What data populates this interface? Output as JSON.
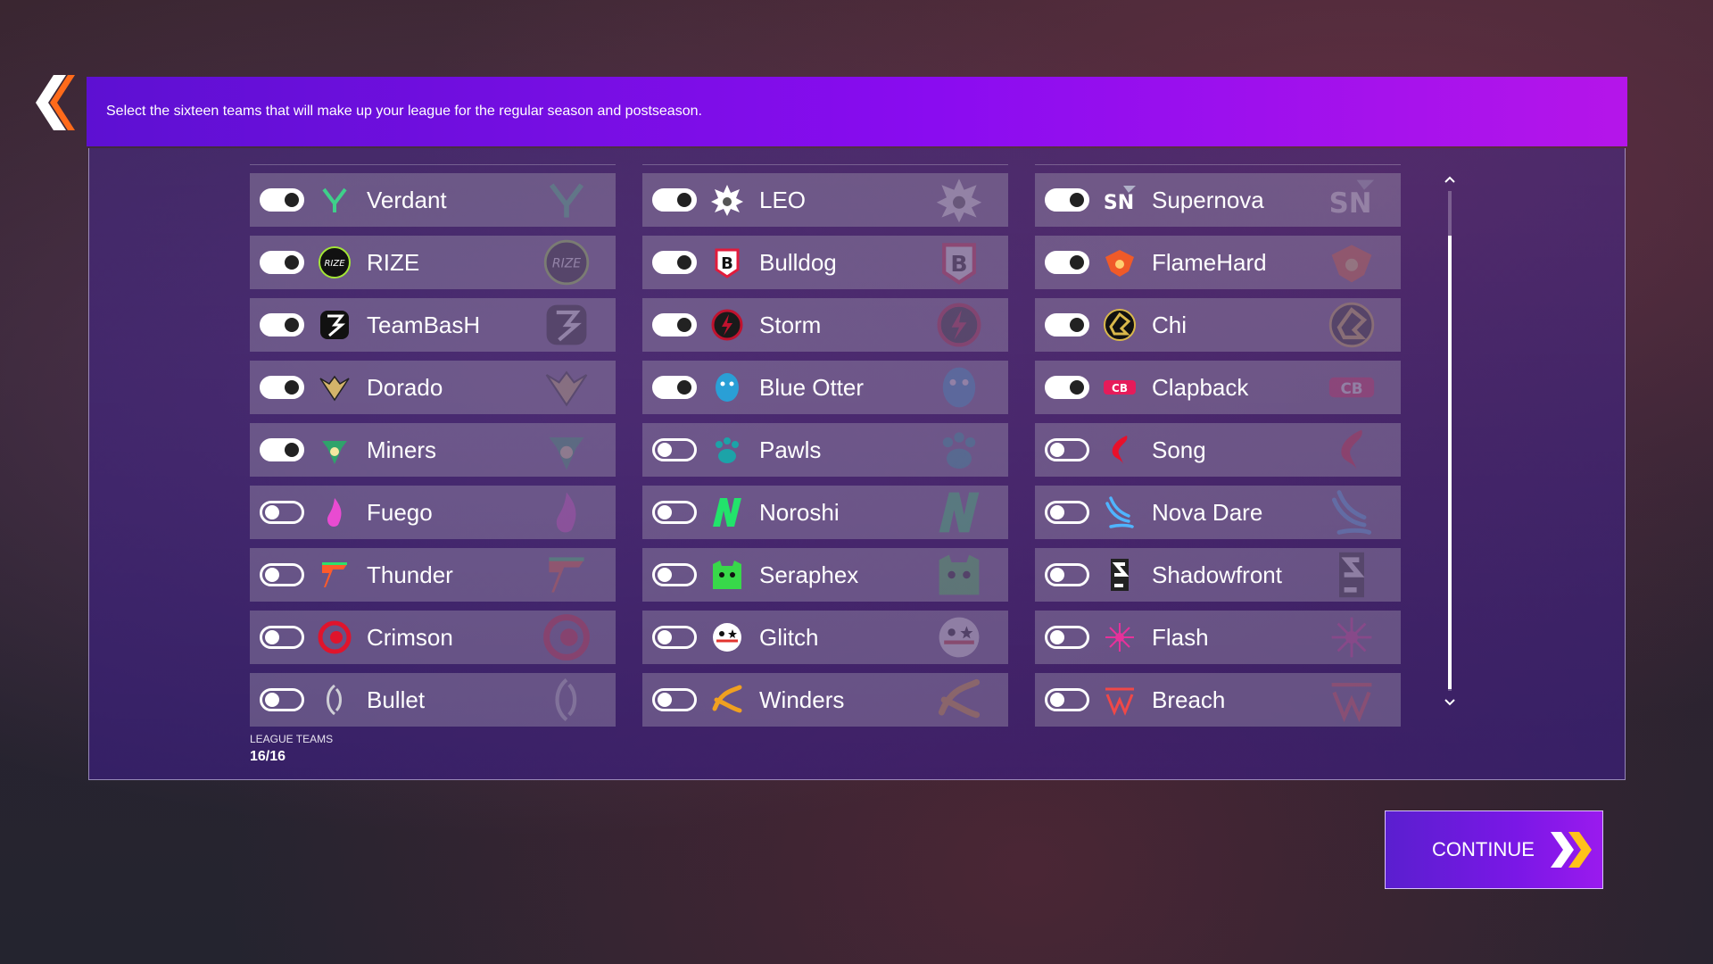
{
  "header": {
    "instruction": "Select the sixteen teams that will make up your league for the regular season and postseason."
  },
  "columns": [
    [
      {
        "name": "Verdant",
        "enabled": true,
        "icon": "verdant-logo-icon",
        "color": "#3fd08a"
      },
      {
        "name": "RIZE",
        "enabled": true,
        "icon": "rize-logo-icon",
        "color": "#a3e635"
      },
      {
        "name": "TeamBasH",
        "enabled": true,
        "icon": "teambash-logo-icon",
        "color": "#111111"
      },
      {
        "name": "Dorado",
        "enabled": true,
        "icon": "dorado-logo-icon",
        "color": "#d4b46a"
      },
      {
        "name": "Miners",
        "enabled": true,
        "icon": "miners-logo-icon",
        "color": "#2fa36b"
      },
      {
        "name": "Fuego",
        "enabled": false,
        "icon": "fuego-logo-icon",
        "color": "#e94bd1"
      },
      {
        "name": "Thunder",
        "enabled": false,
        "icon": "thunder-logo-icon",
        "color": "#ff5a2a"
      },
      {
        "name": "Crimson",
        "enabled": false,
        "icon": "crimson-logo-icon",
        "color": "#e0142c"
      },
      {
        "name": "Bullet",
        "enabled": false,
        "icon": "bullet-logo-icon",
        "color": "#cfcfd6"
      }
    ],
    [
      {
        "name": "LEO",
        "enabled": true,
        "icon": "leo-logo-icon",
        "color": "#ffffff"
      },
      {
        "name": "Bulldog",
        "enabled": true,
        "icon": "bulldog-logo-icon",
        "color": "#e21b3c"
      },
      {
        "name": "Storm",
        "enabled": true,
        "icon": "storm-logo-icon",
        "color": "#c0122e"
      },
      {
        "name": "Blue Otter",
        "enabled": true,
        "icon": "blue-otter-logo-icon",
        "color": "#2a9fd6"
      },
      {
        "name": "Pawls",
        "enabled": false,
        "icon": "pawls-logo-icon",
        "color": "#1ca3a8"
      },
      {
        "name": "Noroshi",
        "enabled": false,
        "icon": "noroshi-logo-icon",
        "color": "#22e36b"
      },
      {
        "name": "Seraphex",
        "enabled": false,
        "icon": "seraphex-logo-icon",
        "color": "#38d84a"
      },
      {
        "name": "Glitch",
        "enabled": false,
        "icon": "glitch-logo-icon",
        "color": "#ffffff"
      },
      {
        "name": "Winders",
        "enabled": false,
        "icon": "winders-logo-icon",
        "color": "#f0a020"
      }
    ],
    [
      {
        "name": "Supernova",
        "enabled": true,
        "icon": "supernova-logo-icon",
        "color": "#ffffff"
      },
      {
        "name": "FlameHard",
        "enabled": true,
        "icon": "flamehard-logo-icon",
        "color": "#f05a28"
      },
      {
        "name": "Chi",
        "enabled": true,
        "icon": "chi-logo-icon",
        "color": "#d9b84a"
      },
      {
        "name": "Clapback",
        "enabled": true,
        "icon": "clapback-logo-icon",
        "color": "#e61b5a"
      },
      {
        "name": "Song",
        "enabled": false,
        "icon": "song-logo-icon",
        "color": "#e8102a"
      },
      {
        "name": "Nova Dare",
        "enabled": false,
        "icon": "nova-dare-logo-icon",
        "color": "#4fb4ff"
      },
      {
        "name": "Shadowfront",
        "enabled": false,
        "icon": "shadowfront-logo-icon",
        "color": "#ffffff"
      },
      {
        "name": "Flash",
        "enabled": false,
        "icon": "flash-logo-icon",
        "color": "#e6319a"
      },
      {
        "name": "Breach",
        "enabled": false,
        "icon": "breach-logo-icon",
        "color": "#ef4848"
      }
    ]
  ],
  "league": {
    "label": "LEAGUE TEAMS",
    "count": "16/16"
  },
  "continue_label": "CONTINUE",
  "colors": {
    "banner_start": "#5d10d2",
    "banner_end": "#b515ea",
    "chevron_accent": "#ff6a1a",
    "continue_chevron": "#ffc21a"
  }
}
